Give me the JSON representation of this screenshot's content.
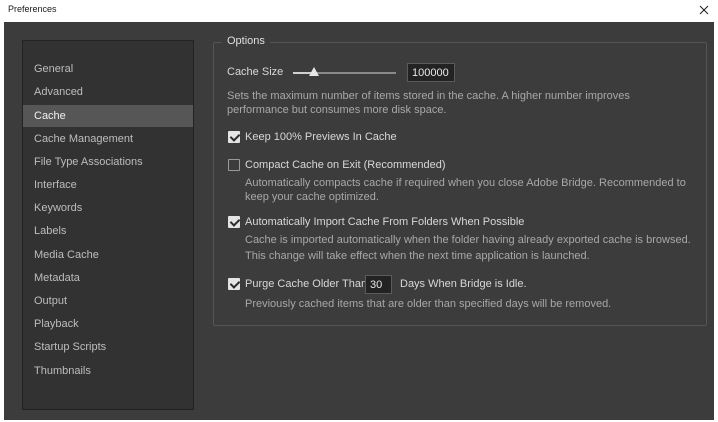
{
  "window": {
    "title": "Preferences"
  },
  "sidebar": {
    "items": [
      {
        "label": "General"
      },
      {
        "label": "Advanced"
      },
      {
        "label": "Cache",
        "selected": true
      },
      {
        "label": "Cache Management"
      },
      {
        "label": "File Type Associations"
      },
      {
        "label": "Interface"
      },
      {
        "label": "Keywords"
      },
      {
        "label": "Labels"
      },
      {
        "label": "Media Cache"
      },
      {
        "label": "Metadata"
      },
      {
        "label": "Output"
      },
      {
        "label": "Playback"
      },
      {
        "label": "Startup Scripts"
      },
      {
        "label": "Thumbnails"
      }
    ]
  },
  "options": {
    "legend": "Options",
    "cache_size": {
      "label": "Cache Size",
      "value": "100000",
      "slider_fraction": 0.2,
      "description_line1": "Sets the maximum number of items stored in the cache. A higher number improves",
      "description_line2": "performance but consumes more disk space."
    },
    "keep_previews": {
      "label": "Keep 100% Previews In Cache",
      "checked": true
    },
    "compact_cache": {
      "label": "Compact Cache on Exit (Recommended)",
      "checked": false,
      "description_line1": "Automatically compacts cache if required when you close Adobe Bridge. Recommended to",
      "description_line2": "keep your cache optimized."
    },
    "auto_import": {
      "label": "Automatically Import Cache From Folders When Possible",
      "checked": true,
      "description_line1": "Cache is imported automatically when the folder having already exported cache is browsed.",
      "description_line2": "This change will take effect when the next time application is launched."
    },
    "purge_cache": {
      "label_before": "Purge Cache Older Than",
      "days_value": "30",
      "label_after": "Days When Bridge is Idle.",
      "checked": true,
      "description": "Previously cached items that are older than specified days will be removed."
    }
  },
  "colors": {
    "window_bg": "#3c3c3c",
    "sidebar_bg": "#323232",
    "selected_item_bg": "#565656",
    "text": "#d8d8d8"
  }
}
